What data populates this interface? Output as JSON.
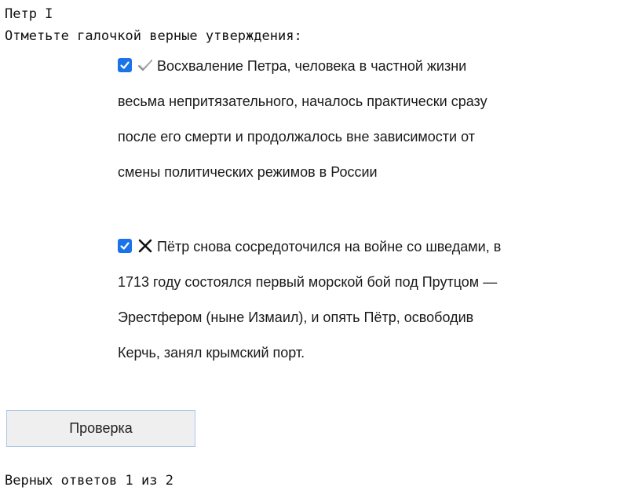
{
  "quiz": {
    "title": "Петр I",
    "instruction": "Отметьте галочкой верные утверждения:",
    "statements": [
      {
        "checked": true,
        "status_icon": "check-mark-icon",
        "text": "Восхваление Петра, человека в частной жизни весьма непритязательного, началось практически сразу после его смерти и продолжалось вне зависимости от смены политических режимов в России"
      },
      {
        "checked": true,
        "status_icon": "cross-mark-icon",
        "text": "Пётр снова сосредоточился на войне со шведами, в 1713 году состоялся первый морской бой под Прутцом — Эрестфером (ныне Измаил), и опять Пётр, освободив Керчь, занял крымский порт."
      }
    ],
    "check_button_label": "Проверка",
    "result": "Верных ответов 1 из 2"
  },
  "colors": {
    "checkbox": "#1a73e8",
    "button_bg": "#efefef",
    "button_border": "#a8c6e6"
  }
}
